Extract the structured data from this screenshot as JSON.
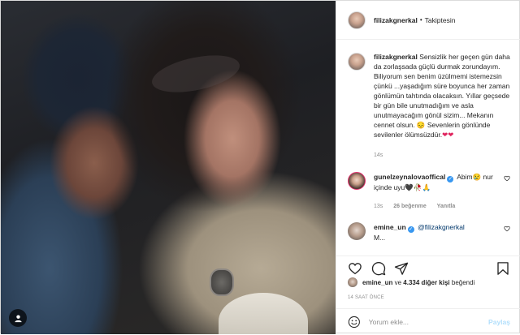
{
  "post": {
    "author": "filizakgnerkal",
    "separator": "•",
    "follow_status": "Takiptesin"
  },
  "caption": {
    "username": "filizakgnerkal",
    "text": "Sensizlik her geçen gün daha da zorlaşsada güçlü durmak zorundayım. Biliyorum sen benim üzülmemi istemezsin çünkü ...yaşadığım süre boyunca her zaman gönlümün tahtında olacaksın. Yıllar geçsede bir gün bile unutmadığım ve asla unutmayacağım gönül sizim... Mekanın cennet olsun. 😔 Sevenlerin gönlünde sevilenler ölümsüzdür.",
    "hearts": "❤❤",
    "age": "14s"
  },
  "comments": [
    {
      "username": "gunelzeynalovaoffical",
      "verified": "✓",
      "text": "Abim😢 nur içinde uyu🖤🥀🙏",
      "age": "13s",
      "likes": "26 beğenme",
      "reply": "Yanıtla"
    },
    {
      "username": "emine_un",
      "verified": "✓",
      "mention": "@filizakgnerkal",
      "text": "M...",
      "age": ""
    }
  ],
  "likes": {
    "user": "emine_un",
    "connector": "ve",
    "count": "4.334 diğer kişi",
    "suffix": "beğendi"
  },
  "timestamp": "14 SAAT ÖNCE",
  "comment_box": {
    "placeholder": "Yorum ekle...",
    "share_label": "Paylaş"
  },
  "icons": {
    "like": "heart-icon",
    "comment": "comment-icon",
    "share": "paper-plane-icon",
    "save": "bookmark-icon",
    "emoji": "smile-icon",
    "tagged": "user-icon"
  },
  "colors": {
    "text": "#262626",
    "muted": "#8e8e8e",
    "link": "#00376b",
    "share_disabled": "#b2dffc",
    "verified": "#3897f0"
  }
}
